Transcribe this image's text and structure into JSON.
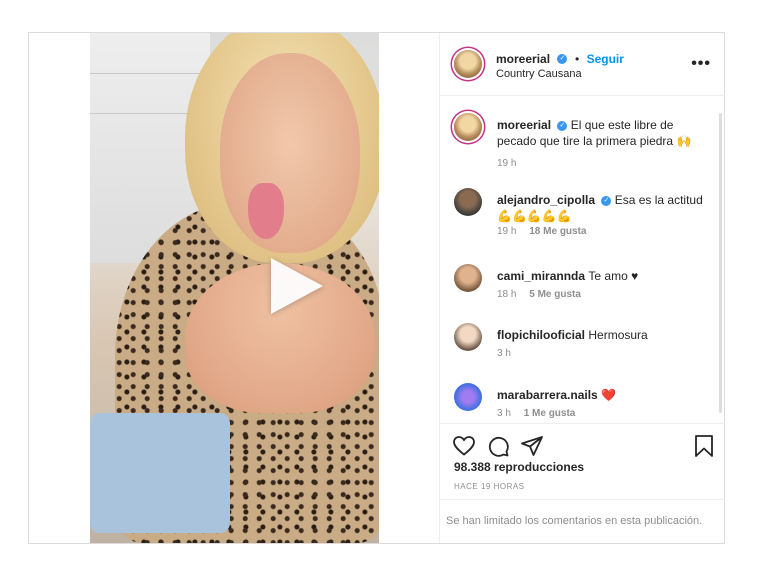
{
  "post": {
    "author": {
      "username": "moreerial",
      "verified": true,
      "follow_label": "Seguir",
      "separator": "•",
      "location": "Country Causana"
    },
    "more_label": "•••",
    "media": {
      "type": "video",
      "play_icon": "play-icon"
    },
    "comments": [
      {
        "username": "moreerial",
        "text": "El que este libre de pecado que tire la primera piedra 🙌",
        "time": "19 h",
        "likes": ""
      },
      {
        "username": "alejandro_cipolla",
        "text": "Esa es la actitud 💪💪💪💪💪",
        "time": "19 h",
        "likes": "18 Me gusta"
      },
      {
        "username": "cami_miranndа",
        "text": "Te amo ♥",
        "time": "18 h",
        "likes": "5 Me gusta"
      },
      {
        "username": "flopichilooficial",
        "text": "Hermosura",
        "time": "3 h",
        "likes": ""
      },
      {
        "username": "marabarrera.nails",
        "text": "❤️",
        "time": "3 h",
        "likes": "1 Me gusta"
      }
    ],
    "actions": [
      "heart-icon",
      "comment-icon",
      "share-icon",
      "bookmark-icon"
    ],
    "views": "98.388 reproducciones",
    "time_ago": "HACE 19 HORAS",
    "comments_limited": "Se han limitado los comentarios en esta publicación."
  },
  "colors": {
    "accent": "#0095f6",
    "verified": "#3897f0",
    "like_red": "#e0245e"
  }
}
